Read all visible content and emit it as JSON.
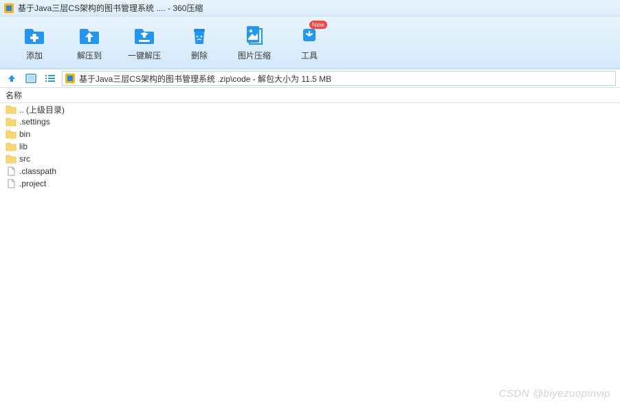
{
  "title": "基于Java三层CS架构的图书管理系统 .... - 360压缩",
  "toolbar": [
    {
      "id": "add",
      "label": "添加"
    },
    {
      "id": "extract-to",
      "label": "解压到"
    },
    {
      "id": "one-click-extract",
      "label": "一键解压"
    },
    {
      "id": "delete",
      "label": "删除"
    },
    {
      "id": "image-compress",
      "label": "图片压缩"
    },
    {
      "id": "tools",
      "label": "工具",
      "badge": "New"
    }
  ],
  "path": "基于Java三层CS架构的图书管理系统 .zip\\code - 解包大小为 11.5 MB",
  "columns": {
    "name": "名称"
  },
  "files": [
    {
      "name": ".. (上级目录)",
      "type": "folder"
    },
    {
      "name": ".settings",
      "type": "folder"
    },
    {
      "name": "bin",
      "type": "folder"
    },
    {
      "name": "lib",
      "type": "folder"
    },
    {
      "name": "src",
      "type": "folder"
    },
    {
      "name": ".classpath",
      "type": "file"
    },
    {
      "name": ".project",
      "type": "file"
    }
  ],
  "watermark": "CSDN @biyezuopinvip",
  "colors": {
    "accent": "#2196f3",
    "toolbar_bg": "#d3e9fb"
  }
}
